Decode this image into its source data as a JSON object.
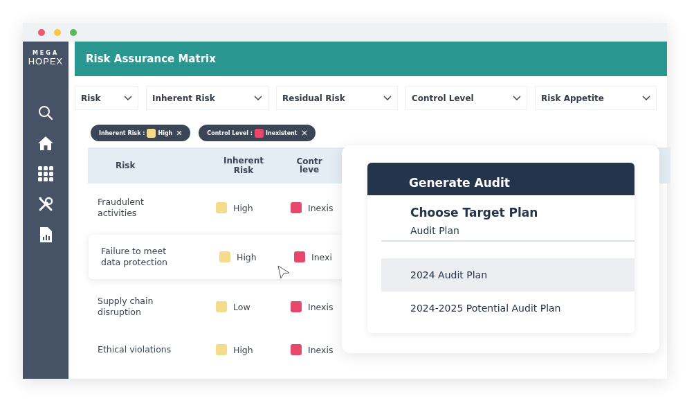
{
  "logo": {
    "top": "MEGA",
    "bottom": "HOPEX"
  },
  "header": {
    "title": "Risk Assurance Matrix"
  },
  "filters": [
    {
      "label": "Risk"
    },
    {
      "label": "Inherent Risk"
    },
    {
      "label": "Residual Risk"
    },
    {
      "label": "Control Level"
    },
    {
      "label": "Risk Appetite"
    }
  ],
  "active_filters": [
    {
      "label": "Inherent Risk :",
      "color": "#f3dc8c",
      "value": "High"
    },
    {
      "label": "Control Level :",
      "color": "#e5486a",
      "value": "Inexistent"
    }
  ],
  "table": {
    "columns": [
      "Risk",
      "Inherent Risk",
      "Contr leve"
    ],
    "rows": [
      {
        "risk": "Fraudulent activities",
        "inherent": {
          "label": "High",
          "color": "#f3dc8c"
        },
        "control": {
          "label": "Inexis",
          "color": "#e5486a"
        },
        "hovered": false
      },
      {
        "risk": "Failure to meet data protection",
        "inherent": {
          "label": "High",
          "color": "#f3dc8c"
        },
        "control": {
          "label": "Inexi",
          "color": "#e5486a"
        },
        "hovered": true
      },
      {
        "risk": "Supply chain disruption",
        "inherent": {
          "label": "Low",
          "color": "#f3dc8c"
        },
        "control": {
          "label": "Inexis",
          "color": "#e5486a"
        },
        "hovered": false
      },
      {
        "risk": "Ethical violations",
        "inherent": {
          "label": "High",
          "color": "#f3dc8c"
        },
        "control": {
          "label": "Inexis",
          "color": "#e5486a"
        },
        "hovered": false
      }
    ]
  },
  "dialog": {
    "title": "Generate Audit",
    "heading": "Choose Target Plan",
    "field_label": "Audit Plan",
    "options": [
      {
        "label": "2024 Audit Plan",
        "selected": true
      },
      {
        "label": "2024-2025 Potential Audit Plan",
        "selected": false
      }
    ]
  }
}
